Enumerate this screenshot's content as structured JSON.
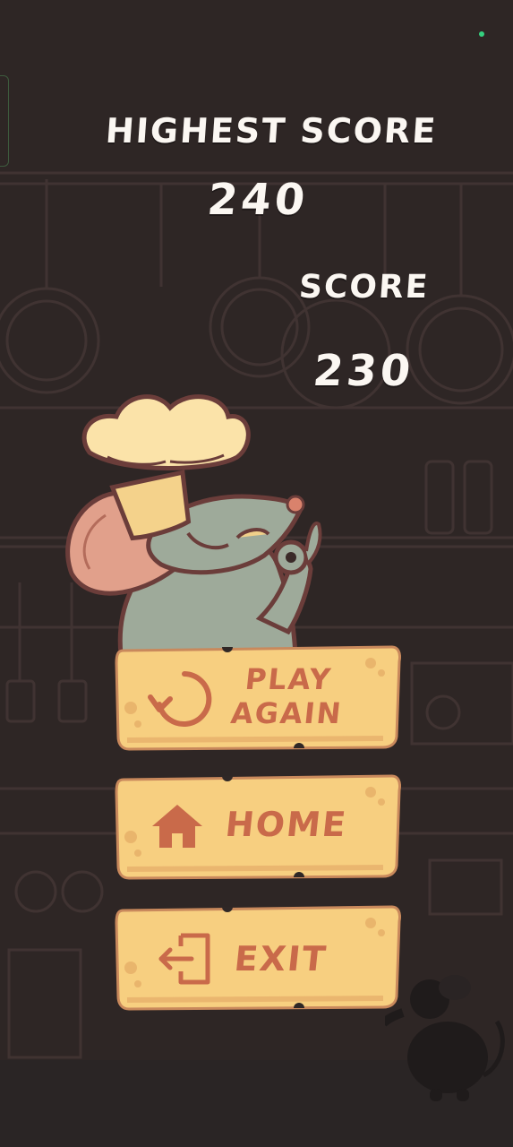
{
  "scores": {
    "highest_label": "HIGHEST SCORE",
    "highest_value": "240",
    "score_label": "SCORE",
    "score_value": "230"
  },
  "buttons": {
    "play_again_line1": "PLAY",
    "play_again_line2": "AGAIN",
    "home": "HOME",
    "exit": "EXIT"
  },
  "colors": {
    "background": "#2f2726",
    "score_text": "#fbf7f2",
    "button_face": "#f7cf80",
    "button_text": "#c96a4a",
    "status_indicator": "#35d07f"
  },
  "icons": {
    "play_again": "restart-icon",
    "home": "house-icon",
    "exit": "exit-door-icon"
  }
}
